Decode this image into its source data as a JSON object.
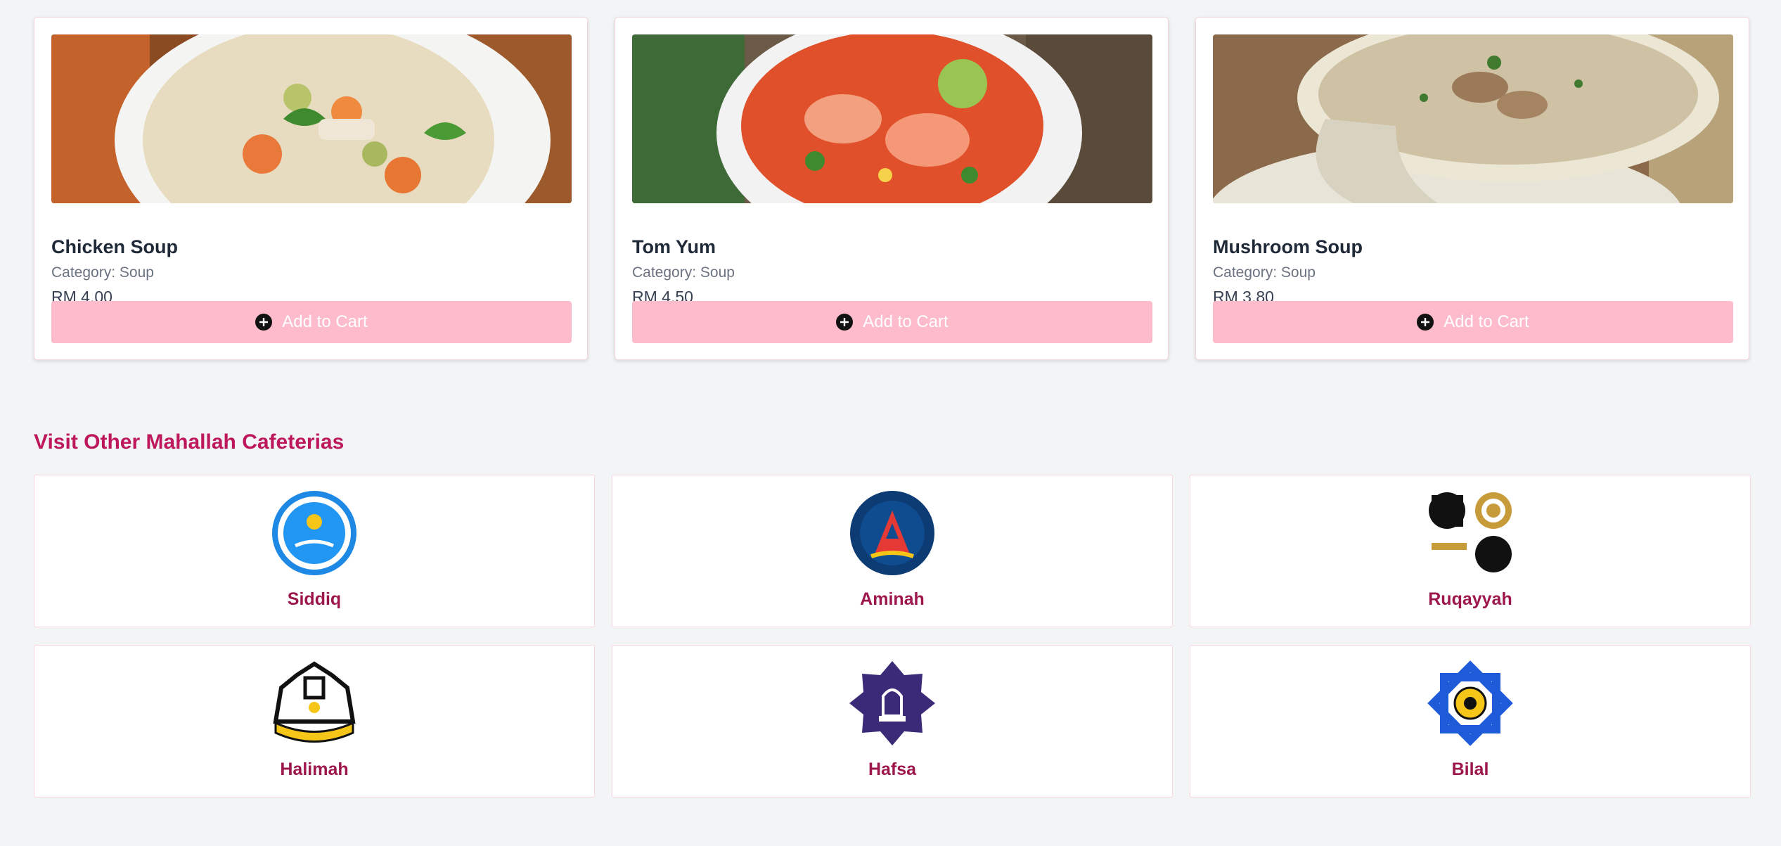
{
  "menu_items": [
    {
      "name": "Chicken Soup",
      "category": "Category: Soup",
      "price": "RM 4.00",
      "button": "Add to Cart",
      "image": "chicken-soup-photo"
    },
    {
      "name": "Tom Yum",
      "category": "Category: Soup",
      "price": "RM 4.50",
      "button": "Add to Cart",
      "image": "tom-yum-photo"
    },
    {
      "name": "Mushroom Soup",
      "category": "Category: Soup",
      "price": "RM 3.80",
      "button": "Add to Cart",
      "image": "mushroom-soup-photo"
    }
  ],
  "other_cafeterias": {
    "title": "Visit Other Mahallah Cafeterias",
    "items": [
      {
        "name": "Siddiq",
        "logo": "siddiq-logo"
      },
      {
        "name": "Aminah",
        "logo": "aminah-logo"
      },
      {
        "name": "Ruqayyah",
        "logo": "ruqayyah-logo"
      },
      {
        "name": "Halimah",
        "logo": "halimah-logo"
      },
      {
        "name": "Hafsa",
        "logo": "hafsa-logo"
      },
      {
        "name": "Bilal",
        "logo": "bilal-logo"
      }
    ]
  },
  "colors": {
    "accent": "#be185d",
    "cart_button": "#fdbbcb",
    "background": "#f3f4f6"
  }
}
